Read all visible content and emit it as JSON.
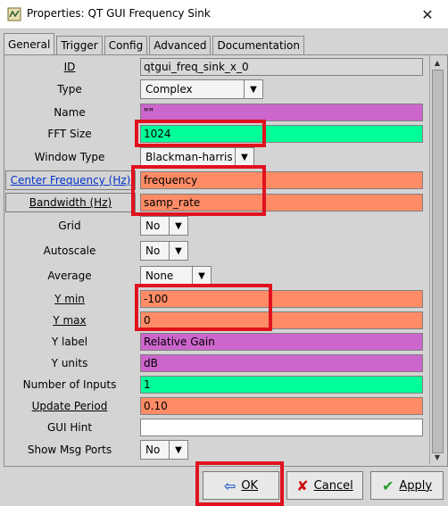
{
  "window": {
    "title": "Properties: QT GUI Frequency Sink",
    "close": "✕",
    "icon": "gnuradio-properties-icon"
  },
  "tabs": [
    "General",
    "Trigger",
    "Config",
    "Advanced",
    "Documentation"
  ],
  "params": {
    "id": {
      "label": "ID",
      "value": "qtgui_freq_sink_x_0"
    },
    "type": {
      "label": "Type",
      "value": "Complex"
    },
    "name": {
      "label": "Name",
      "value": "\"\""
    },
    "fft_size": {
      "label": "FFT Size",
      "value": "1024"
    },
    "window_type": {
      "label": "Window Type",
      "value": "Blackman-harris"
    },
    "center_freq": {
      "label": "Center Frequency (Hz)",
      "value": "frequency"
    },
    "bandwidth": {
      "label": "Bandwidth (Hz)",
      "value": "samp_rate"
    },
    "grid": {
      "label": "Grid",
      "value": "No"
    },
    "autoscale": {
      "label": "Autoscale",
      "value": "No"
    },
    "average": {
      "label": "Average",
      "value": "None"
    },
    "ymin": {
      "label": "Y min",
      "value": "-100"
    },
    "ymax": {
      "label": "Y max",
      "value": "0"
    },
    "ylabel": {
      "label": "Y label",
      "value": "Relative Gain"
    },
    "yunits": {
      "label": "Y units",
      "value": "dB"
    },
    "num_inputs": {
      "label": "Number of Inputs",
      "value": "1"
    },
    "update_period": {
      "label": "Update Period",
      "value": "0.10"
    },
    "gui_hint": {
      "label": "GUI Hint",
      "value": ""
    },
    "show_msg_ports": {
      "label": "Show Msg Ports",
      "value": "No"
    }
  },
  "buttons": {
    "ok": "OK",
    "cancel": "Cancel",
    "apply": "Apply"
  },
  "colors": {
    "purple": "#cc66cc",
    "green": "#00ff99",
    "orange": "#ff8c66",
    "gray_field": "#d8d8d8",
    "white": "#ffffff",
    "highlight": "#e0121e"
  }
}
